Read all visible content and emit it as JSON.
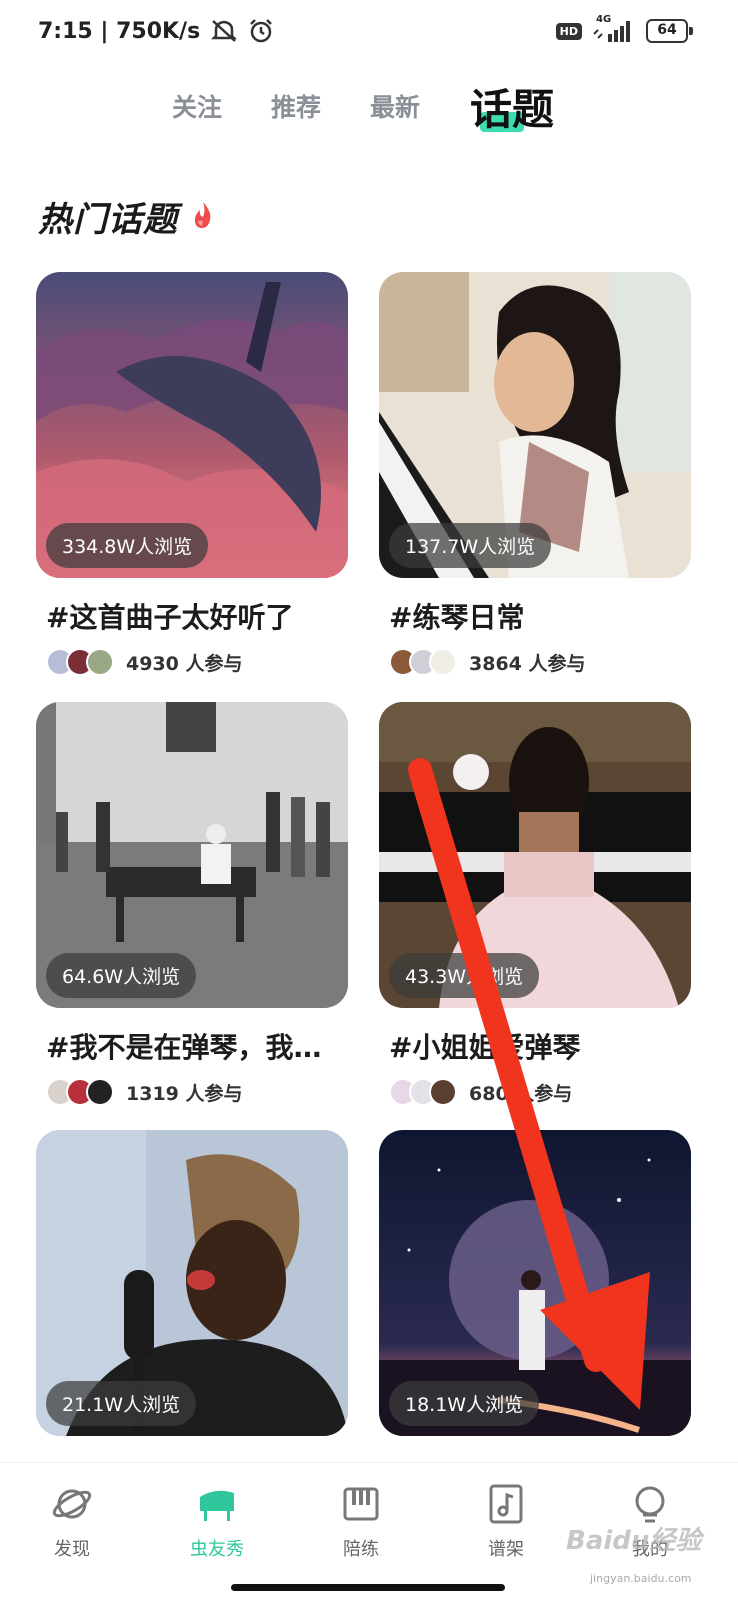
{
  "status_bar": {
    "time_speed": "7:15 | 750K/s",
    "network": "4G",
    "hd": "HD",
    "battery": "64"
  },
  "tabs": [
    {
      "label": "关注"
    },
    {
      "label": "推荐"
    },
    {
      "label": "最新"
    },
    {
      "label": "话题",
      "active": true
    }
  ],
  "section": {
    "title": "热门话题"
  },
  "cards": [
    {
      "views": "334.8W人浏览",
      "title": "#这首曲子太好听了",
      "participants": "4930 人参与"
    },
    {
      "views": "137.7W人浏览",
      "title": "#练琴日常",
      "participants": "3864 人参与"
    },
    {
      "views": "64.6W人浏览",
      "title": "#我不是在弹琴，我…",
      "participants": "1319 人参与"
    },
    {
      "views": "43.3W人浏览",
      "title": "#小姐姐爱弹琴",
      "participants": "680 人参与"
    },
    {
      "views": "21.1W人浏览",
      "title": "",
      "participants": ""
    },
    {
      "views": "18.1W人浏览",
      "title": "",
      "participants": ""
    }
  ],
  "bottom_nav": [
    {
      "label": "发现",
      "icon": "planet-icon"
    },
    {
      "label": "虫友秀",
      "icon": "piano-icon",
      "active": true
    },
    {
      "label": "陪练",
      "icon": "keyboard-icon"
    },
    {
      "label": "谱架",
      "icon": "music-note-icon"
    },
    {
      "label": "我的",
      "icon": "bulb-avatar-icon"
    }
  ],
  "colors": {
    "accent": "#2fc79b",
    "tab_highlight": "#3ddcb1",
    "arrow": "#f0341e"
  },
  "watermark": {
    "brand": "Baidu经验",
    "url": "jingyan.baidu.com"
  }
}
